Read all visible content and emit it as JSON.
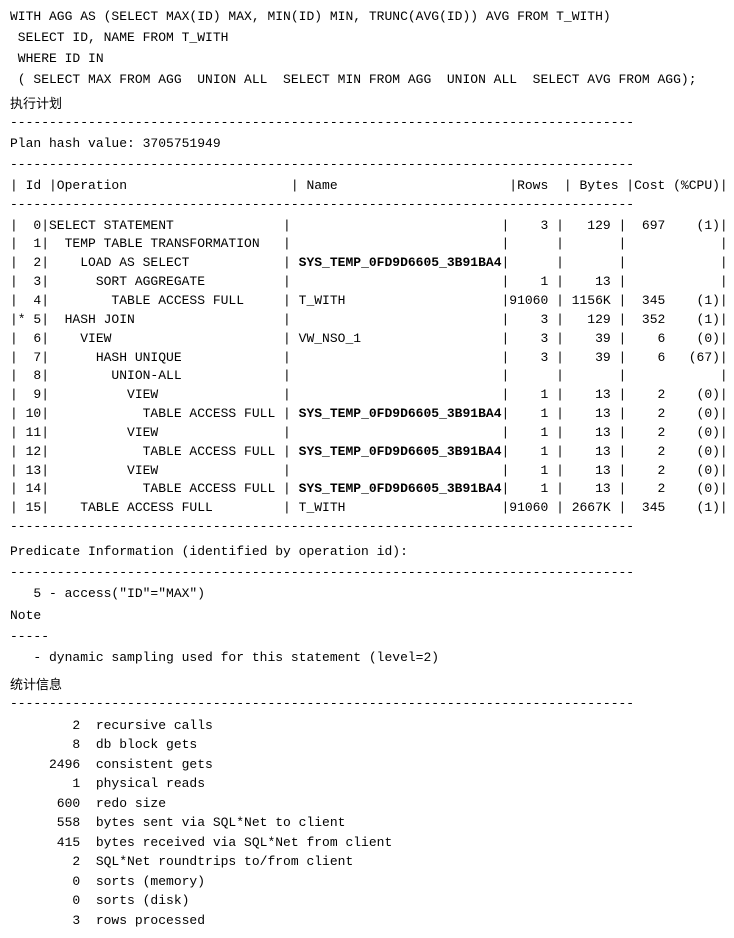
{
  "sql": {
    "line1": "WITH AGG AS (SELECT MAX(ID) MAX, MIN(ID) MIN, TRUNC(AVG(ID)) AVG FROM T_WITH)",
    "line2": " SELECT ID, NAME FROM T_WITH",
    "line3": " WHERE ID IN",
    "line4": " ( SELECT MAX FROM AGG  UNION ALL  SELECT MIN FROM AGG  UNION ALL  SELECT AVG FROM AGG);"
  },
  "section_execution": "执行计划",
  "divider_char": "--------------------------------------------------------------------------------",
  "plan_hash": "Plan hash value: 3705751949",
  "table": {
    "header": "| Id |Operation                     | Name                      |Rows  | Bytes |Cost (%CPU)|",
    "separator": "--------------------------------------------------------------------------------",
    "rows": [
      "|  0|SELECT STATEMENT              |                           |    3 |   129 |  697    (1)|",
      "|  1|  TEMP TABLE TRANSFORMATION   |                           |      |       |            |",
      "|  2|    LOAD AS SELECT            | SYS_TEMP_0FD9D6605_3B91BA4|      |       |            |",
      "|  3|      SORT AGGREGATE          |                           |    1 |    13 |            |",
      "|  4|        TABLE ACCESS FULL     | T_WITH                    |91060 | 1156K |  345    (1)|",
      "|* 5|  HASH JOIN                   |                           |    3 |   129 |  352    (1)|",
      "|  6|    VIEW                      | VW_NSO_1                  |    3 |    39 |    6    (0)|",
      "|  7|      HASH UNIQUE             |                           |    3 |    39 |    6   (67)|",
      "|  8|        UNION-ALL             |                           |      |       |            |",
      "|  9|          VIEW                |                           |    1 |    13 |    2    (0)|",
      "| 10|            TABLE ACCESS FULL | SYS_TEMP_0FD9D6605_3B91BA4|    1 |    13 |    2    (0)|",
      "| 11|          VIEW                |                           |    1 |    13 |    2    (0)|",
      "| 12|            TABLE ACCESS FULL | SYS_TEMP_0FD9D6605_3B91BA4|    1 |    13 |    2    (0)|",
      "| 13|          VIEW                |                           |    1 |    13 |    2    (0)|",
      "| 14|            TABLE ACCESS FULL | SYS_TEMP_0FD9D6605_3B91BA4|    1 |    13 |    2    (0)|",
      "| 15|    TABLE ACCESS FULL         | T_WITH                    |91060 | 2667K |  345    (1)|"
    ]
  },
  "predicate_title": "Predicate Information (identified by operation id):",
  "predicate_content": "   5 - access(\"ID\"=\"MAX\")",
  "note_title": "Note",
  "note_dashes": "-----",
  "note_content": "   - dynamic sampling used for this statement (level=2)",
  "stats_title": "统计信息",
  "stats": [
    "        2  recursive calls",
    "        8  db block gets",
    "     2496  consistent gets",
    "        1  physical reads",
    "      600  redo size",
    "      558  bytes sent via SQL*Net to client",
    "      415  bytes received via SQL*Net from client",
    "        2  SQL*Net roundtrips to/from client",
    "        0  sorts (memory)",
    "        0  sorts (disk)",
    "        3  rows processed"
  ]
}
